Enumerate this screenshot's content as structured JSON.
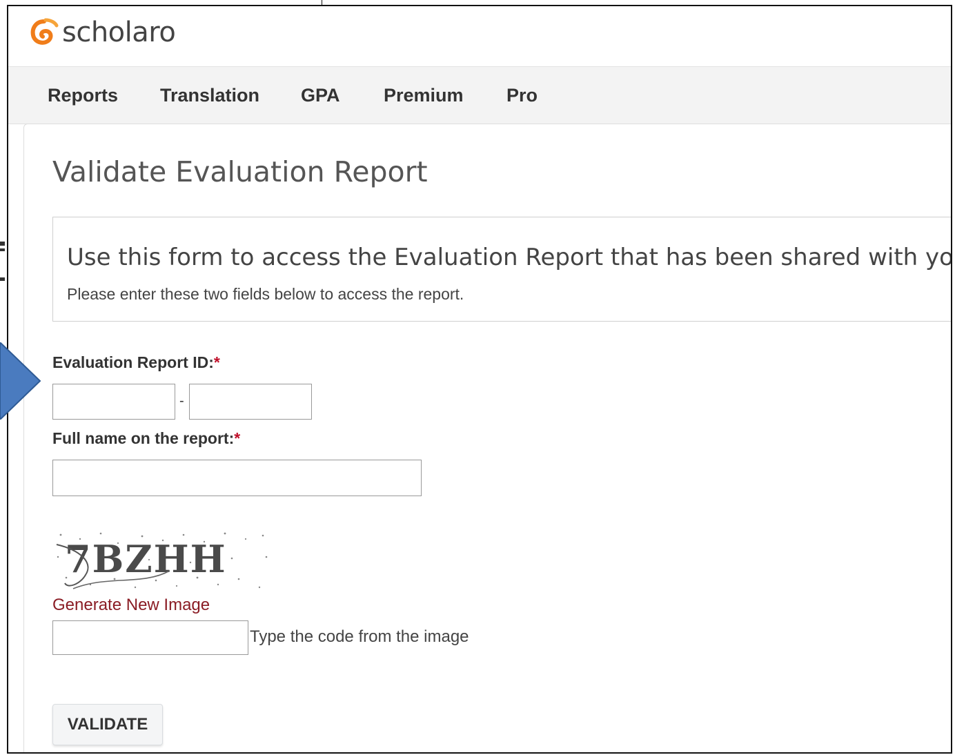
{
  "brand": {
    "name": "scholaro"
  },
  "nav": {
    "items": [
      {
        "label": "Reports"
      },
      {
        "label": "Translation"
      },
      {
        "label": "GPA"
      },
      {
        "label": "Premium"
      },
      {
        "label": "Pro"
      }
    ]
  },
  "page": {
    "title": "Validate Evaluation Report"
  },
  "info": {
    "lead": "Use this form to access the Evaluation Report that has been shared with you.",
    "sub": "Please enter these two fields below to access the report."
  },
  "form": {
    "report_id_label": "Evaluation Report ID:",
    "required_mark": "*",
    "id_separator": "-",
    "report_id_part1": "",
    "report_id_part2": "",
    "full_name_label": "Full name on the report:",
    "full_name_value": "",
    "captcha_code": "7BZHH",
    "generate_link": "Generate New Image",
    "captcha_input_value": "",
    "captcha_hint": "Type the code from the image",
    "submit_label": "VALIDATE"
  },
  "colors": {
    "link": "#8a1c24",
    "required": "#c0102a",
    "arrow": "#4a7bbf",
    "logo_orange": "#f07d1a"
  }
}
